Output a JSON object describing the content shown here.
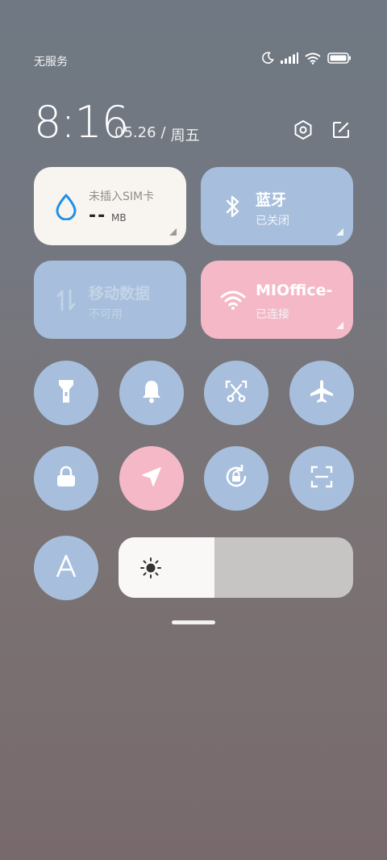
{
  "status_bar": {
    "carrier": "无服务",
    "icons": [
      "moon-icon",
      "signal-icon",
      "wifi-icon",
      "battery-icon"
    ]
  },
  "header": {
    "time": "8:16",
    "date": "05.26",
    "separator": "/",
    "weekday": "周五",
    "icons": [
      "settings-hexagon-icon",
      "edit-icon"
    ]
  },
  "tiles": {
    "data_usage": {
      "title": "未插入SIM卡",
      "value": "--",
      "unit": "MB",
      "icon": "water-drop-icon"
    },
    "bluetooth": {
      "title": "蓝牙",
      "status": "已关闭",
      "icon": "bluetooth-icon"
    },
    "mobile_data": {
      "title": "移动数据",
      "status": "不可用",
      "icon": "data-arrows-icon"
    },
    "wifi": {
      "title": "MIOffice-",
      "status": "已连接",
      "icon": "wifi-icon"
    }
  },
  "toggles": [
    {
      "name": "flashlight",
      "icon": "flashlight-icon",
      "active": false
    },
    {
      "name": "silent",
      "icon": "bell-icon",
      "active": false
    },
    {
      "name": "screenshot",
      "icon": "scissors-screenshot-icon",
      "active": false
    },
    {
      "name": "airplane-mode",
      "icon": "airplane-icon",
      "active": false
    },
    {
      "name": "lock-screen",
      "icon": "lock-icon",
      "active": false
    },
    {
      "name": "location",
      "icon": "location-arrow-icon",
      "active": true
    },
    {
      "name": "rotation-lock",
      "icon": "rotation-lock-icon",
      "active": false
    },
    {
      "name": "scanner",
      "icon": "scan-icon",
      "active": false
    },
    {
      "name": "auto-brightness",
      "icon": "letter-a-icon",
      "label": "A",
      "active": false
    }
  ],
  "brightness": {
    "level": 0.41,
    "icon": "sun-icon"
  },
  "colors": {
    "tile_blue": "#a7bfdc",
    "tile_pink": "#f4b8c6",
    "tile_white": "#f8f5f0",
    "drop_blue": "#1e90e8"
  }
}
